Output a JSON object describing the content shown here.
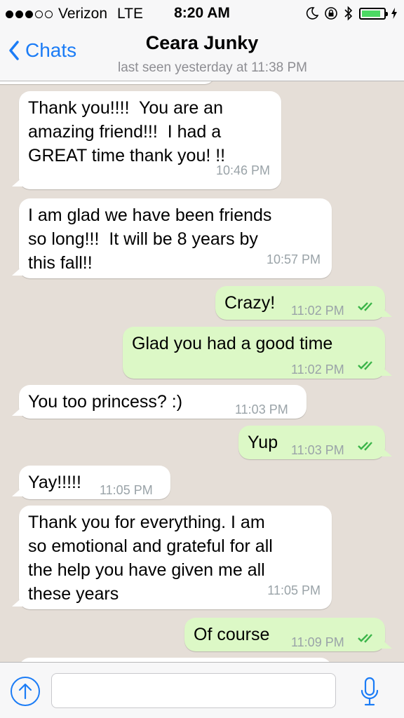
{
  "status_bar": {
    "carrier": "Verizon",
    "network": "LTE",
    "time": "8:20 AM",
    "signal_bars_filled": 3,
    "signal_bars_total": 5,
    "battery_level": 0.85
  },
  "header": {
    "back_label": "Chats",
    "title": "Ceara Junky",
    "subtitle": "last seen yesterday at 11:38 PM"
  },
  "messages": [
    {
      "direction": "incoming",
      "lines": [
        "Thank you!!!!  You are an",
        "amazing friend!!!  I had a",
        "GREAT time thank you! !!"
      ],
      "time": "10:46 PM"
    },
    {
      "direction": "incoming",
      "lines": [
        "I am glad we have been friends",
        "so long!!!  It will be 8 years by",
        "this fall!!"
      ],
      "time": "10:57 PM"
    },
    {
      "direction": "outgoing",
      "lines": [
        "Crazy!"
      ],
      "time": "11:02 PM",
      "read": true
    },
    {
      "direction": "outgoing",
      "lines": [
        "Glad you had a good time"
      ],
      "time": "11:02 PM",
      "read": true
    },
    {
      "direction": "incoming",
      "lines": [
        "You too princess? :)"
      ],
      "time": "11:03 PM"
    },
    {
      "direction": "outgoing",
      "lines": [
        "Yup"
      ],
      "time": "11:03 PM",
      "read": true
    },
    {
      "direction": "incoming",
      "lines": [
        "Yay!!!!!"
      ],
      "time": "11:05 PM"
    },
    {
      "direction": "incoming",
      "lines": [
        "Thank you for everything. I am",
        "so emotional and grateful for all",
        "the help you have given me all",
        "these years"
      ],
      "time": "11:05 PM"
    },
    {
      "direction": "outgoing",
      "lines": [
        "Of course"
      ],
      "time": "11:09 PM",
      "read": true
    }
  ],
  "input": {
    "placeholder": "",
    "value": ""
  },
  "colors": {
    "accent": "#1b7cf6",
    "incoming_bubble": "#ffffff",
    "outgoing_bubble": "#dcf8c6",
    "read_ticks": "#3cb54a",
    "chat_background": "#e5ded7"
  }
}
